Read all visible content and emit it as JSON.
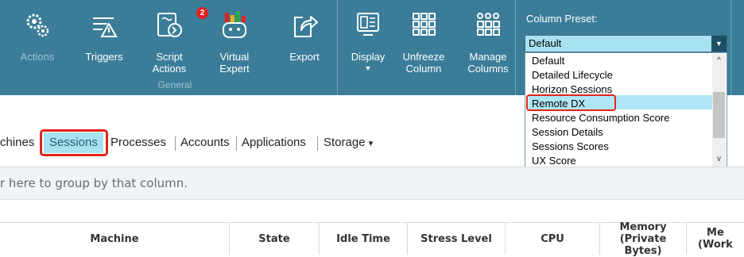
{
  "ribbon": {
    "buttons": [
      {
        "label": "Actions"
      },
      {
        "label": "Triggers"
      },
      {
        "label": "Script\nActions"
      },
      {
        "label": "Virtual\nExpert"
      },
      {
        "label": "Export"
      },
      {
        "label": "Display"
      },
      {
        "label": "Unfreeze\nColumn"
      },
      {
        "label": "Manage\nColumns"
      }
    ],
    "script_badge": "2",
    "group_label": "General",
    "preset_title": "Column Preset:",
    "preset_value": "Default",
    "preset_options": [
      "Default",
      "Detailed Lifecycle",
      "Horizon Sessions",
      "Remote DX",
      "Resource Consumption Score",
      "Session Details",
      "Sessions Scores",
      "UX Score"
    ],
    "accent": "#3b7d99"
  },
  "tabs": {
    "items": [
      "chines",
      "Sessions",
      "Processes",
      "Accounts",
      "Applications",
      "Storage"
    ],
    "dropdown_glyph": "▾"
  },
  "group_bar": {
    "text": "r here to group by that column."
  },
  "table": {
    "headers": [
      "Machine",
      "State",
      "Idle Time",
      "Stress Level",
      "CPU",
      "Memory\n(Private Bytes)",
      "Me\n(Work"
    ]
  }
}
